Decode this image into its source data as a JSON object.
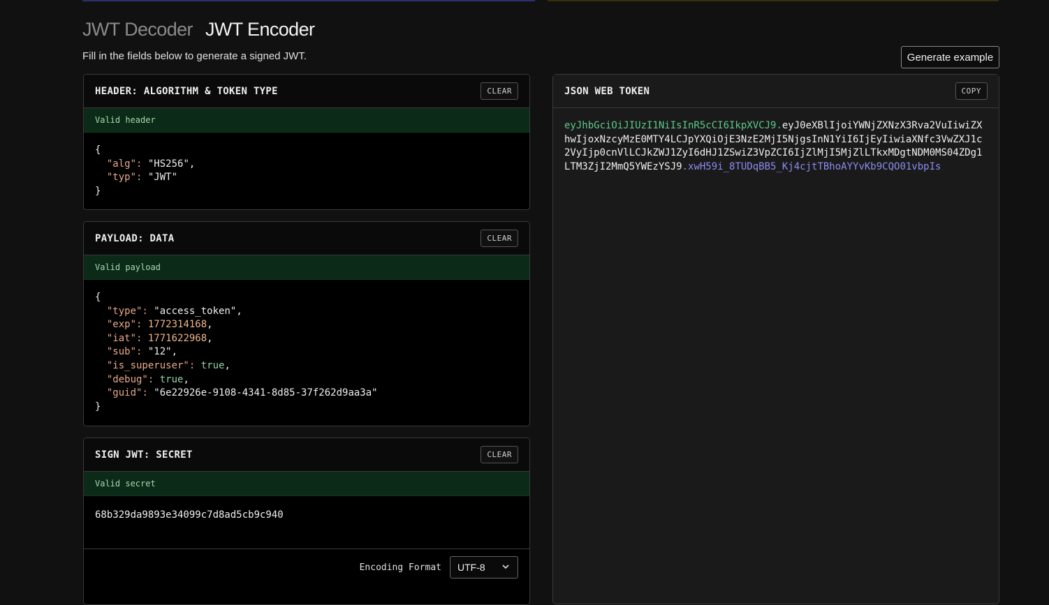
{
  "tabs": {
    "decoder": "JWT Decoder",
    "encoder": "JWT Encoder"
  },
  "subtitle": "Fill in the fields below to generate a signed JWT.",
  "generate_button": "Generate example",
  "header_panel": {
    "title": "HEADER: ALGORITHM & TOKEN TYPE",
    "clear": "CLEAR",
    "status": "Valid header",
    "fields": [
      {
        "key": "\"alg\"",
        "value": "\"HS256\"",
        "type": "s"
      },
      {
        "key": "\"typ\"",
        "value": "\"JWT\"",
        "type": "s"
      }
    ]
  },
  "payload_panel": {
    "title": "PAYLOAD: DATA",
    "clear": "CLEAR",
    "status": "Valid payload",
    "fields": [
      {
        "key": "\"type\"",
        "value": "\"access_token\"",
        "type": "s"
      },
      {
        "key": "\"exp\"",
        "value": "1772314168",
        "type": "n"
      },
      {
        "key": "\"iat\"",
        "value": "1771622968",
        "type": "n"
      },
      {
        "key": "\"sub\"",
        "value": "\"12\"",
        "type": "s"
      },
      {
        "key": "\"is_superuser\"",
        "value": "true",
        "type": "b"
      },
      {
        "key": "\"debug\"",
        "value": "true",
        "type": "b"
      },
      {
        "key": "\"guid\"",
        "value": "\"6e22926e-9108-4341-8d85-37f262d9aa3a\"",
        "type": "s"
      }
    ]
  },
  "secret_panel": {
    "title": "SIGN JWT: SECRET",
    "clear": "CLEAR",
    "status": "Valid secret",
    "secret": "68b329da9893e34099c7d8ad5cb9c940",
    "encoding_label": "Encoding Format",
    "encoding_value": "UTF-8"
  },
  "jwt_panel": {
    "title": "JSON WEB TOKEN",
    "copy": "COPY",
    "token_header": "eyJhbGciOiJIUzI1NiIsInR5cCI6IkpXVCJ9",
    "token_payload": "eyJ0eXBlIjoiYWNjZXNzX3Rva2VuIiwiZXhwIjoxNzcyMzE0MTY4LCJpYXQiOjE3NzE2MjI5NjgsInN1YiI6IjEyIiwiaXNfc3VwZXJ1c2VyIjp0cnVlLCJkZWJ1ZyI6dHJ1ZSwiZ3VpZCI6IjZlMjI5MjZlLTkxMDgtNDM0MS04ZDg1LTM3ZjI2MmQ5YWEzYSJ9",
    "token_signature": "xwH59i_8TUDqBB5_Kj4cjtTBhoAYYvKb9CQO01vbpIs",
    "dot": "."
  },
  "colors": {
    "jwt_header": "#5cc98a",
    "jwt_payload": "#f0f0f0",
    "jwt_signature": "#8c8cf0",
    "valid_bar": "#0b2a17"
  },
  "icons": {
    "select_chevron": "chevron-down-icon"
  }
}
